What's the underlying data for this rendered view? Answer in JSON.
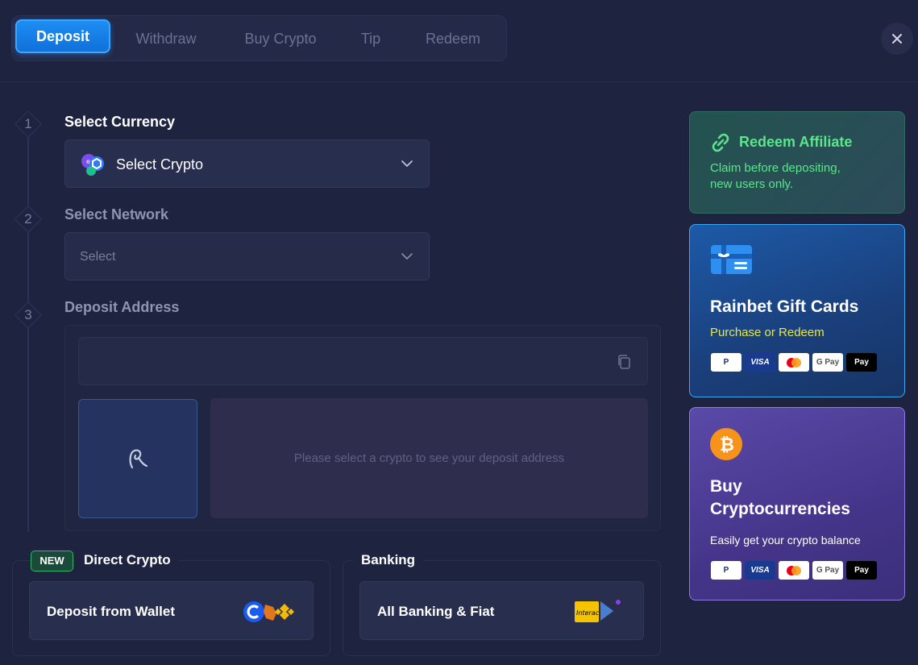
{
  "tabs": [
    {
      "label": "Deposit",
      "active": true
    },
    {
      "label": "Withdraw",
      "active": false
    },
    {
      "label": "Buy Crypto",
      "active": false
    },
    {
      "label": "Tip",
      "active": false
    },
    {
      "label": "Redeem",
      "active": false
    }
  ],
  "close_icon": "close-icon",
  "steps": [
    {
      "number": "1",
      "title": "Select Currency"
    },
    {
      "number": "2",
      "title": "Select Network"
    },
    {
      "number": "3",
      "title": "Deposit Address"
    }
  ],
  "currency_select": {
    "value": "Select Crypto",
    "icon": "crypto-multi-icon"
  },
  "network_select": {
    "placeholder": "Select"
  },
  "deposit_address": {
    "value": "",
    "message": "Please select a crypto to see your deposit address"
  },
  "direct_crypto": {
    "badge": "NEW",
    "title": "Direct Crypto",
    "action": "Deposit from Wallet"
  },
  "banking": {
    "title": "Banking",
    "action": "All Banking & Fiat"
  },
  "affiliate_card": {
    "title": "Redeem Affiliate",
    "subtitle_line1": "Claim before depositing,",
    "subtitle_line2": "new users only."
  },
  "gift_card": {
    "title": "Rainbet Gift Cards",
    "subtitle": "Purchase or Redeem"
  },
  "buy_card": {
    "title_line1": "Buy",
    "title_line2": "Cryptocurrencies",
    "subtitle": "Easily get your crypto balance"
  },
  "payment_methods": [
    "P",
    "VISA",
    "",
    "G Pay",
    " Pay"
  ],
  "colors": {
    "background": "#1e2340",
    "accent_blue": "#1e8ff5",
    "affiliate_green": "#5be58c",
    "gift_yellow": "#e6e84a",
    "new_badge_green": "#2fb86a"
  }
}
